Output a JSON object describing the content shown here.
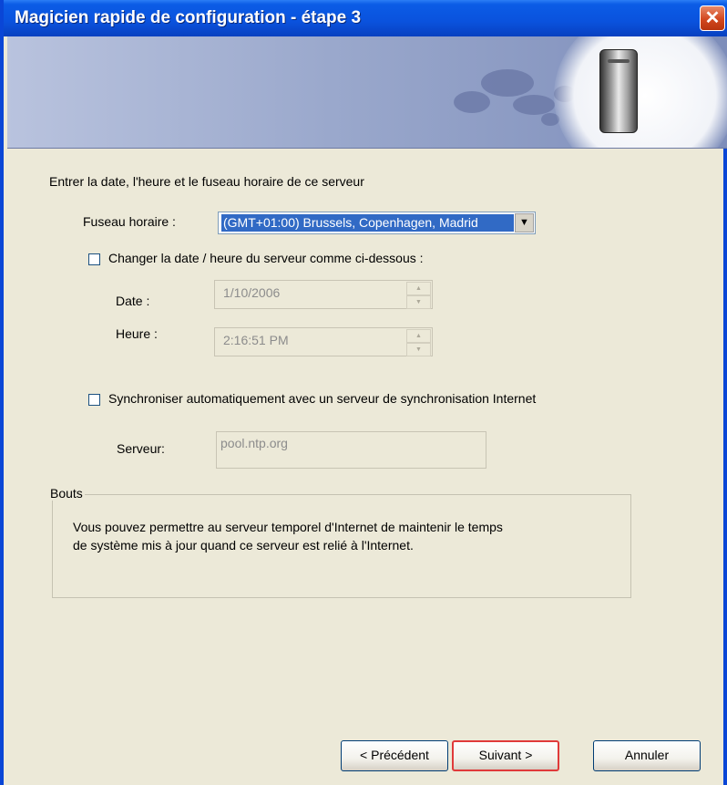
{
  "window": {
    "title": "Magicien rapide de configuration - étape 3",
    "close_glyph": "✕"
  },
  "main": {
    "instruction": "Entrer la date, l'heure et le fuseau horaire de ce serveur",
    "timezone": {
      "label": "Fuseau horaire :",
      "selected": "(GMT+01:00) Brussels, Copenhagen, Madrid",
      "arrow_glyph": "▼"
    },
    "change_datetime": {
      "label": "Changer la date / heure du serveur comme ci-dessous :",
      "checked": false
    },
    "date": {
      "label": "Date :",
      "value": "1/10/2006"
    },
    "time": {
      "label": "Heure :",
      "value": "2:16:51 PM"
    },
    "sync": {
      "label": "Synchroniser automatiquement avec un serveur de synchronisation Internet",
      "checked": false
    },
    "server": {
      "label": "Serveur:",
      "value": "pool.ntp.org"
    },
    "tips": {
      "title": "Bouts",
      "line1": "Vous pouvez permettre au serveur temporel d'Internet de maintenir le temps",
      "line2": "de système mis à jour quand ce serveur est relié à l'Internet."
    }
  },
  "footer": {
    "back_label": "< Précédent",
    "next_label": "Suivant >",
    "cancel_label": "Annuler"
  },
  "icons": {
    "spin_up": "▲",
    "spin_down": "▼"
  },
  "colors": {
    "titlebar": "#0a52dd",
    "selection": "#316ac5",
    "default_button_border": "#e03a3a"
  }
}
